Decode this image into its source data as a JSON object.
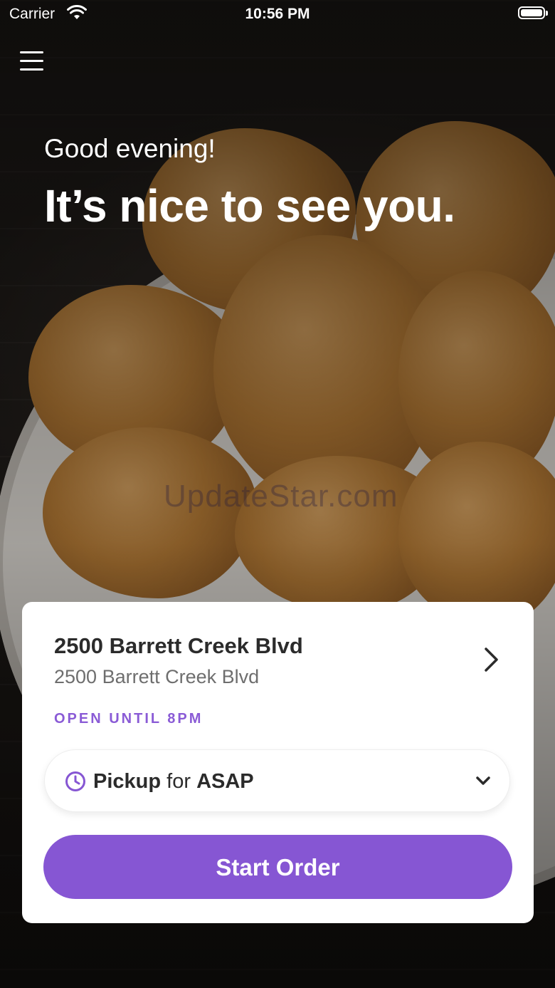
{
  "status_bar": {
    "carrier": "Carrier",
    "time": "10:56 PM"
  },
  "hero": {
    "greeting": "Good evening!",
    "headline": "It’s nice to see you.",
    "watermark": "UpdateStar.com"
  },
  "location_card": {
    "name": "2500 Barrett Creek Blvd",
    "address": "2500 Barrett Creek Blvd",
    "hours": "OPEN UNTIL 8PM",
    "pickup": {
      "mode": "Pickup",
      "connector": "for",
      "time": "ASAP"
    },
    "start_button": "Start Order"
  },
  "colors": {
    "accent": "#8656d3",
    "hours_text": "#8a5bd6",
    "card_bg": "#ffffff"
  },
  "icons": {
    "menu": "hamburger-menu-icon",
    "wifi": "wifi-icon",
    "battery": "battery-icon",
    "chevron_right": "chevron-right-icon",
    "clock": "clock-icon",
    "chevron_down": "chevron-down-icon"
  }
}
